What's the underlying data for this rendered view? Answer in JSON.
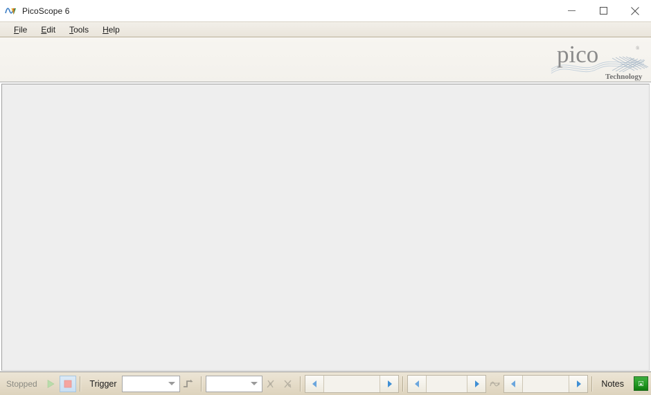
{
  "window": {
    "title": "PicoScope 6",
    "icon": "picoscope-waveform-icon",
    "controls": {
      "minimize": "minimize-icon",
      "maximize": "maximize-icon",
      "close": "close-icon"
    }
  },
  "menubar": {
    "items": [
      {
        "mnemonic": "F",
        "rest": "ile"
      },
      {
        "mnemonic": "E",
        "rest": "dit"
      },
      {
        "mnemonic": "T",
        "rest": "ools"
      },
      {
        "mnemonic": "H",
        "rest": "elp"
      }
    ]
  },
  "banner": {
    "logo_wordmark": "pico",
    "logo_subtitle": "Technology",
    "logo_trademark": "®"
  },
  "main": {
    "scope_area": "",
    "background_color": "#eeeeee"
  },
  "bottombar": {
    "status_label": "Stopped",
    "start_button": "play-icon",
    "stop_button": "stop-icon",
    "trigger_label": "Trigger",
    "trigger_mode_value": "",
    "trigger_mode_placeholder": "",
    "trigger_edge_icon": "rising-edge-trigger-icon",
    "trigger_source_value": "",
    "trigger_source_placeholder": "",
    "marker_tool_1_icon": "trigger-marker-rising-icon",
    "marker_tool_2_icon": "trigger-marker-falling-icon",
    "trigger_level_value": "",
    "pretrigger_value": "",
    "waveform_nav_icon": "waveform-buffer-icon",
    "buffer_value": "",
    "notes_label": "Notes",
    "notes_icon": "notes-image-icon"
  },
  "colors": {
    "titlebar_bg": "#ffffff",
    "menubar_bg": "#efebe2",
    "banner_bg": "#f5f3ee",
    "scope_bg": "#eeeeee",
    "toolbar_bg": "#e6ddca",
    "notes_green": "#239a23",
    "arrow_blue": "#5b9bd5",
    "stop_red": "#f5a0a0",
    "play_green": "#b4d8a8"
  }
}
